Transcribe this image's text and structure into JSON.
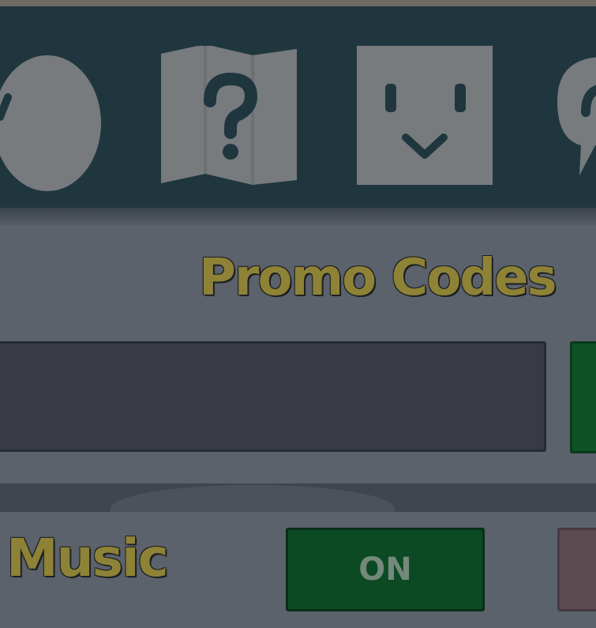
{
  "toolbar": {
    "icons": [
      {
        "name": "egg-icon"
      },
      {
        "name": "map-help-icon"
      },
      {
        "name": "face-icon"
      },
      {
        "name": "chat-icon"
      }
    ]
  },
  "promo": {
    "title": "Promo Codes",
    "input_value": "",
    "input_placeholder": ""
  },
  "settings": {
    "music_label": "Music",
    "music_on_label": "ON"
  },
  "colors": {
    "toolbar_bg": "#20363f",
    "icon_gray": "#777b7e",
    "label_gold": "#8d8236",
    "on_green": "#0c4a24",
    "off_red": "#5d4b52"
  }
}
